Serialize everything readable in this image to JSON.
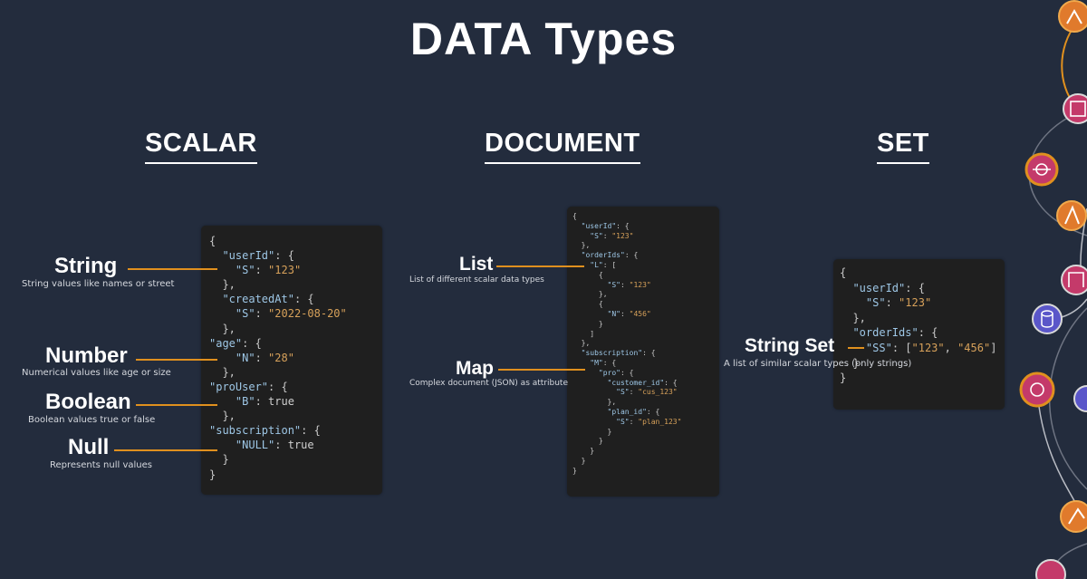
{
  "title": "DATA Types",
  "sections": {
    "scalar": "SCALAR",
    "document": "DOCUMENT",
    "set": "SET"
  },
  "scalar_labels": [
    {
      "name": "String",
      "desc": "String values like names or street"
    },
    {
      "name": "Number",
      "desc": "Numerical values like age or size"
    },
    {
      "name": "Boolean",
      "desc": "Boolean values true or false"
    },
    {
      "name": "Null",
      "desc": "Represents null values"
    }
  ],
  "document_labels": [
    {
      "name": "List",
      "desc": "List of different scalar data types"
    },
    {
      "name": "Map",
      "desc": "Complex document (JSON) as attribute"
    }
  ],
  "set_labels": [
    {
      "name": "String Set",
      "desc": "A list of similar scalar types (only strings)"
    }
  ],
  "scalar_code": {
    "user_key": "\"userId\"",
    "user_type": "\"S\"",
    "user_val": "\"123\"",
    "created_key": "\"createdAt\"",
    "created_type": "\"S\"",
    "created_val": "\"2022-08-20\"",
    "age_key": "\"age\"",
    "age_type": "\"N\"",
    "age_val": "\"28\"",
    "pro_key": "\"proUser\"",
    "pro_type": "\"B\"",
    "pro_val": "true",
    "sub_key": "\"subscription\"",
    "sub_type": "\"NULL\"",
    "sub_val": "true"
  },
  "document_code": {
    "user_key": "\"userId\"",
    "user_type": "\"S\"",
    "user_val": "\"123\"",
    "order_key": "\"orderIds\"",
    "list_type": "\"L\"",
    "item1_type": "\"S\"",
    "item1_val": "\"123\"",
    "item2_type": "\"N\"",
    "item2_val": "\"456\"",
    "sub_key": "\"subscription\"",
    "map_type": "\"M\"",
    "pro_key": "\"pro\"",
    "cust_key": "\"customer_id\"",
    "cust_type": "\"S\"",
    "cust_val": "\"cus_123\"",
    "plan_key": "\"plan_id\"",
    "plan_type": "\"S\"",
    "plan_val": "\"plan_123\""
  },
  "set_code": {
    "user_key": "\"userId\"",
    "user_type": "\"S\"",
    "user_val": "\"123\"",
    "order_key": "\"orderIds\"",
    "ss_type": "\"SS\"",
    "ss_val1": "\"123\"",
    "ss_val2": "\"456\""
  },
  "colors": {
    "background": "#232c3d",
    "code_bg": "#1f1f1f",
    "connector": "#e0901e",
    "key": "#9ec7e6",
    "string": "#d7a15a"
  },
  "decor_icons": [
    "lambda-icon",
    "api-gateway-icon",
    "step-functions-icon",
    "dynamodb-icon",
    "eventbridge-icon",
    "sns-icon"
  ]
}
